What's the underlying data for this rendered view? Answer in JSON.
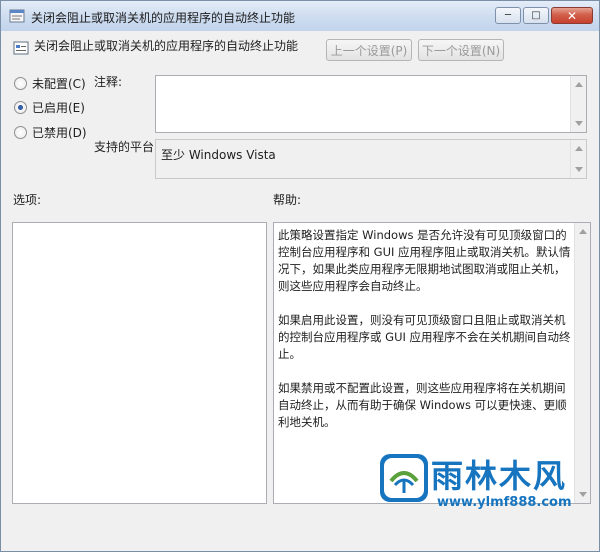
{
  "window": {
    "title": "关闭会阻止或取消关机的应用程序的自动终止功能",
    "buttons": {
      "minimize": "─",
      "maximize": "□",
      "close": "✕"
    }
  },
  "header": {
    "text": "关闭会阻止或取消关机的应用程序的自动终止功能",
    "prev_label": "上一个设置(P)",
    "next_label": "下一个设置(N)"
  },
  "options": [
    {
      "label": "未配置(C)",
      "selected": false
    },
    {
      "label": "已启用(E)",
      "selected": true
    },
    {
      "label": "已禁用(D)",
      "selected": false
    }
  ],
  "comment": {
    "label": "注释:",
    "value": ""
  },
  "platform": {
    "label": "支持的平台:",
    "value": "至少 Windows Vista"
  },
  "options_label": "选项:",
  "help": {
    "label": "帮助:",
    "paragraphs": [
      "此策略设置指定 Windows 是否允许没有可见顶级窗口的控制台应用程序和 GUI 应用程序阻止或取消关机。默认情况下，如果此类应用程序无限期地试图取消或阻止关机，则这些应用程序会自动终止。",
      "如果启用此设置，则没有可见顶级窗口且阻止或取消关机的控制台应用程序或 GUI 应用程序不会在关机期间自动终止。",
      "如果禁用或不配置此设置，则这些应用程序将在关机期间自动终止，从而有助于确保 Windows 可以更快速、更顺利地关机。"
    ]
  },
  "watermark": {
    "title": "雨林木风",
    "url": "www.ylmf888.com"
  },
  "colors": {
    "accent": "#1775c0",
    "titlebar": "#c2d4ec",
    "close": "#c8412d"
  }
}
